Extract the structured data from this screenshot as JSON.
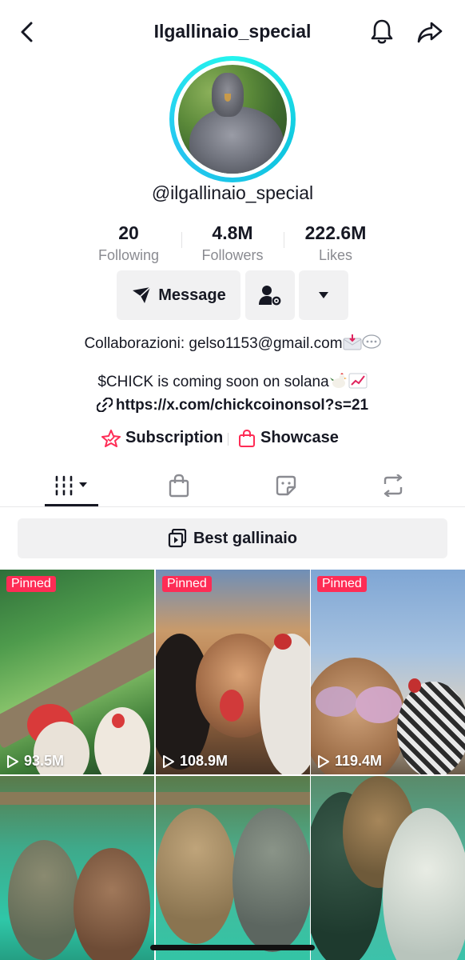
{
  "header": {
    "title": "Ilgallinaio_special",
    "back_icon": "chevron-left-icon",
    "notify_icon": "bell-icon",
    "share_icon": "share-icon"
  },
  "profile": {
    "username": "@ilgallinaio_special",
    "avatar_ring_color": "#25f4ee"
  },
  "stats": [
    {
      "value": "20",
      "label": "Following"
    },
    {
      "value": "4.8M",
      "label": "Followers"
    },
    {
      "value": "222.6M",
      "label": "Likes"
    }
  ],
  "actions": {
    "message_label": "Message",
    "add_friend_icon": "person-gear-icon",
    "more_icon": "caret-down-icon"
  },
  "bio": {
    "line1": "Collaborazioni: gelso1153@gmail.com",
    "line2": "$CHICK is coming soon on solana",
    "link": "https://x.com/chickcoinonsol?s=21"
  },
  "links": {
    "subscription": "Subscription",
    "showcase": "Showcase"
  },
  "tabs": [
    {
      "name": "videos",
      "icon": "grid-icon",
      "active": true
    },
    {
      "name": "shop",
      "icon": "bag-icon",
      "active": false
    },
    {
      "name": "stickers",
      "icon": "sticker-icon",
      "active": false
    },
    {
      "name": "reposts",
      "icon": "repost-icon",
      "active": false
    }
  ],
  "playlist": {
    "label": "Best gallinaio"
  },
  "videos": [
    {
      "pinned": "Pinned",
      "views": "93.5M"
    },
    {
      "pinned": "Pinned",
      "views": "108.9M"
    },
    {
      "pinned": "Pinned",
      "views": "119.4M"
    },
    {
      "pinned": "",
      "views": ""
    },
    {
      "pinned": "",
      "views": ""
    },
    {
      "pinned": "",
      "views": ""
    }
  ],
  "colors": {
    "accent": "#fe2c55",
    "text": "#161823",
    "muted": "#8a8b91",
    "button_bg": "#f1f1f2"
  }
}
